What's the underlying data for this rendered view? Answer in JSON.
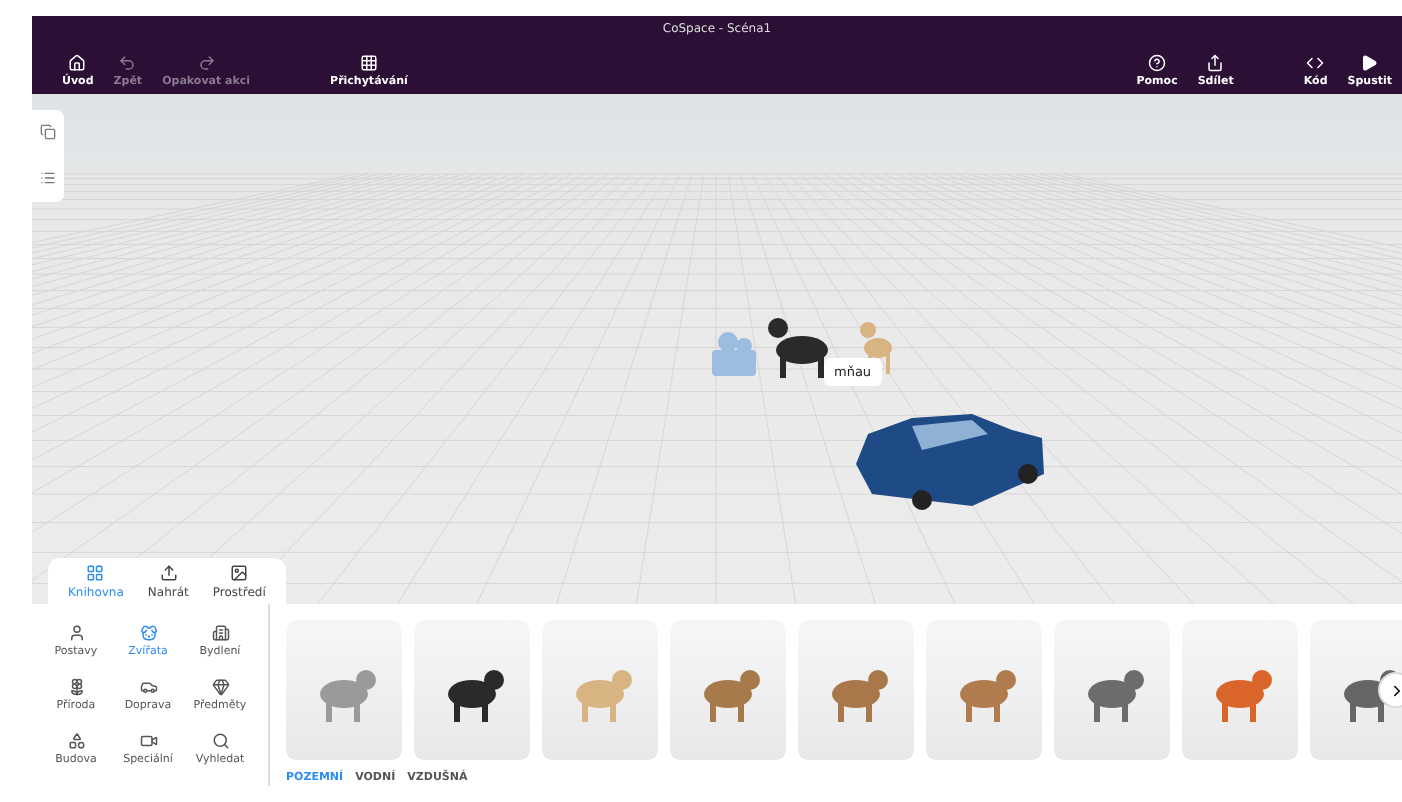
{
  "window": {
    "title": "CoSpace - Scéna1"
  },
  "toolbar_left": [
    {
      "label": "Úvod",
      "disabled": false
    },
    {
      "label": "Zpět",
      "disabled": true
    },
    {
      "label": "Opakovat akci",
      "disabled": true
    }
  ],
  "snap_button": {
    "label": "Přichytávání"
  },
  "toolbar_right": [
    {
      "label": "Pomoc"
    },
    {
      "label": "Sdílet"
    }
  ],
  "code_button": {
    "label": "Kód"
  },
  "run_button": {
    "label": "Spustit"
  },
  "scene": {
    "speech_bubble": "mňau"
  },
  "panel_tabs": [
    {
      "label": "Knihovna",
      "selected": true
    },
    {
      "label": "Nahrát",
      "selected": false
    },
    {
      "label": "Prostředí",
      "selected": false
    }
  ],
  "categories": [
    {
      "label": "Postavy",
      "selected": false
    },
    {
      "label": "Zvířata",
      "selected": true
    },
    {
      "label": "Bydlení",
      "selected": false
    },
    {
      "label": "Příroda",
      "selected": false
    },
    {
      "label": "Doprava",
      "selected": false
    },
    {
      "label": "Předměty",
      "selected": false
    },
    {
      "label": "Budova",
      "selected": false
    },
    {
      "label": "Speciální",
      "selected": false
    },
    {
      "label": "Vyhledat",
      "selected": false
    }
  ],
  "subcategories": [
    {
      "label": "POZEMNÍ",
      "selected": true
    },
    {
      "label": "VODNÍ",
      "selected": false
    },
    {
      "label": "VZDUŠNÁ",
      "selected": false
    }
  ]
}
